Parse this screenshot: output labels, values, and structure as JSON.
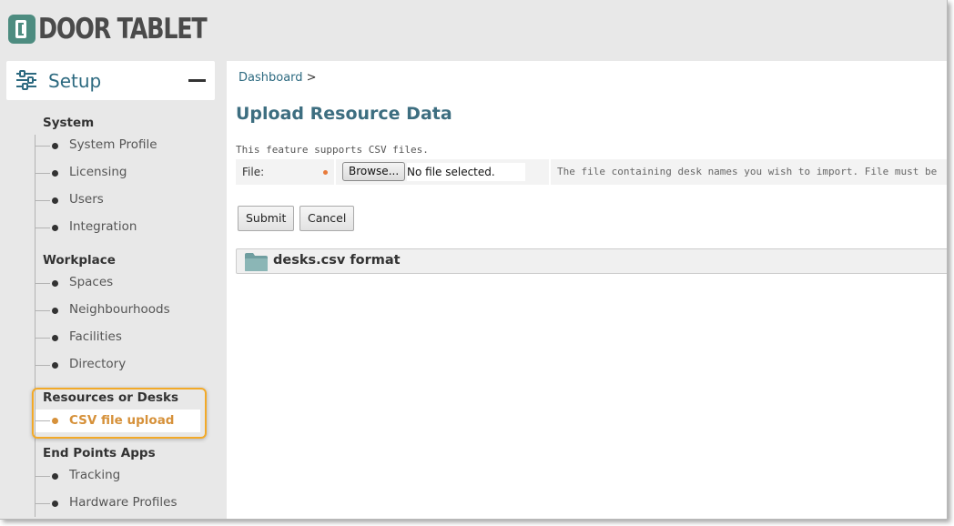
{
  "app": {
    "logo_text": "DOOR TABLET"
  },
  "sidebar": {
    "title": "Setup",
    "sections": [
      {
        "heading": "System",
        "items": [
          "System Profile",
          "Licensing",
          "Users",
          "Integration"
        ]
      },
      {
        "heading": "Workplace",
        "items": [
          "Spaces",
          "Neighbourhoods",
          "Facilities",
          "Directory"
        ]
      },
      {
        "heading": "Resources or Desks",
        "items": [
          "CSV file upload"
        ]
      },
      {
        "heading": "End Points Apps",
        "items": [
          "Tracking",
          "Hardware Profiles"
        ]
      }
    ],
    "active_item": "CSV file upload"
  },
  "main": {
    "breadcrumb": {
      "link": "Dashboard",
      "separator": ">"
    },
    "title": "Upload Resource Data",
    "note": "This feature supports CSV files.",
    "file_field": {
      "label": "File:",
      "browse_label": "Browse...",
      "value": "No file selected.",
      "help": "The file containing desk names you wish to import. File must be"
    },
    "buttons": {
      "submit": "Submit",
      "cancel": "Cancel"
    },
    "accordion": {
      "title": "desks.csv format"
    }
  },
  "colors": {
    "brand": "#4d8c80",
    "title": "#3d6e80",
    "link": "#2d6a80",
    "active": "#d6913a",
    "highlight_border": "#f2a928",
    "required_dot": "#e87a3a"
  },
  "icons": {
    "logo": "door-logo-icon",
    "setup": "sliders-icon",
    "collapse": "minus-icon",
    "accordion": "folder-icon"
  }
}
